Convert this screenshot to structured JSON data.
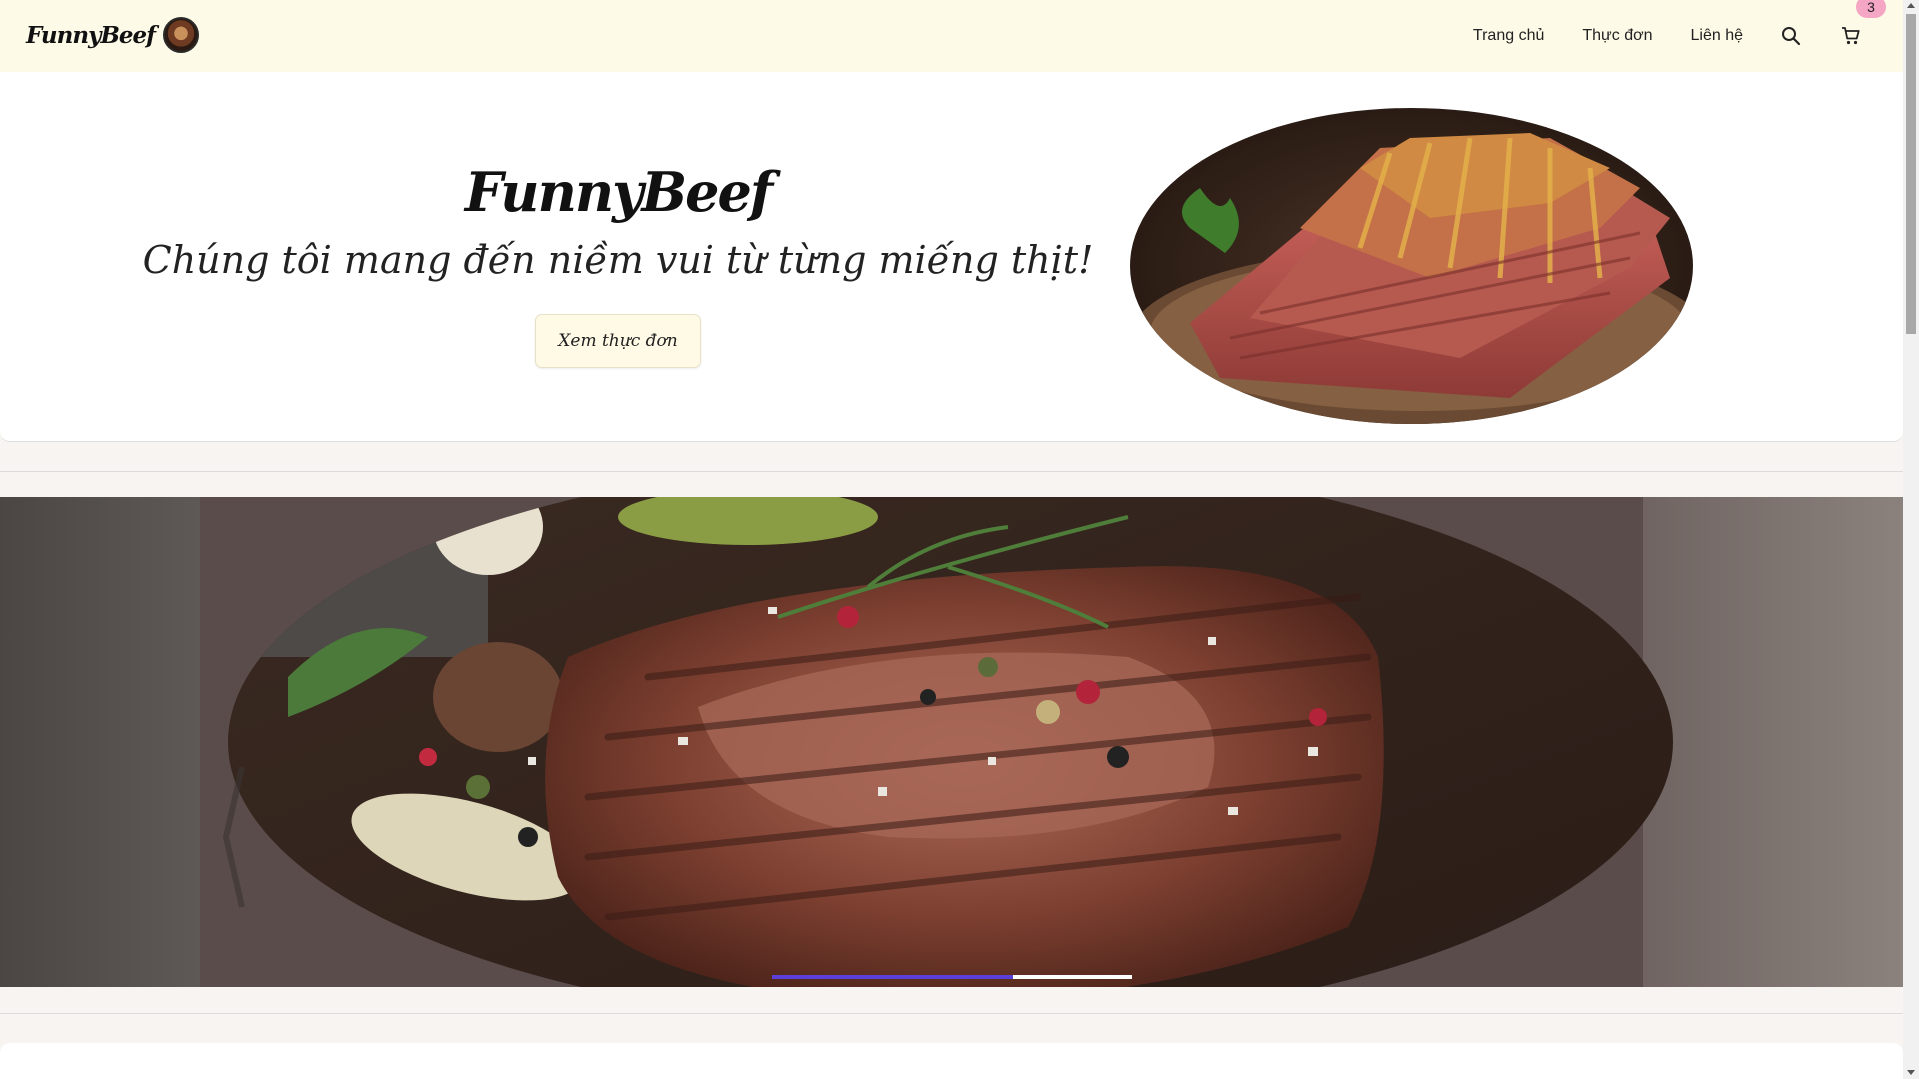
{
  "header": {
    "brand": "FunnyBeef",
    "nav": [
      {
        "label": "Trang chủ"
      },
      {
        "label": "Thực đơn"
      },
      {
        "label": "Liên hệ"
      }
    ],
    "cart_count": "3"
  },
  "hero": {
    "title": "FunnyBeef",
    "tagline": "Chúng tôi mang đến niềm vui từ từng miếng thịt!",
    "cta_label": "Xem thực đơn"
  },
  "banner": {
    "progress": 0.67
  },
  "colors": {
    "header_bg": "#fefae8",
    "accent": "#5b3fd8",
    "badge": "#f5a6c4"
  }
}
